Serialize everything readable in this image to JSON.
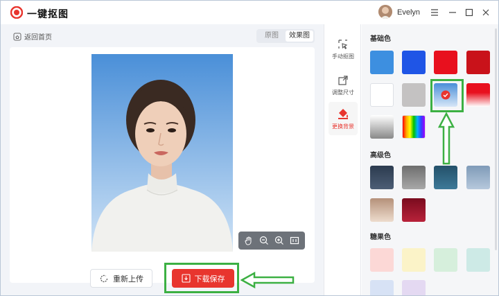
{
  "app": {
    "title": "一键抠图",
    "username": "Evelyn"
  },
  "toolbar": {
    "back_label": "返回首页",
    "view_original": "原图",
    "view_result": "效果图"
  },
  "actions": {
    "reupload_label": "重新上传",
    "download_label": "下载保存"
  },
  "tools": [
    {
      "label": "手动抠图",
      "icon": "cursor-select-icon"
    },
    {
      "label": "调整尺寸",
      "icon": "resize-icon"
    },
    {
      "label": "更换背景",
      "icon": "paint-bucket-icon"
    }
  ],
  "colors": {
    "accent_red": "#e8352e",
    "highlight_green": "#3cb043"
  },
  "panel": {
    "basic_title": "基础色",
    "advanced_title": "高级色",
    "candy_title": "糖果色",
    "basic_swatches": [
      "#3d8fe0",
      "#1f55e6",
      "#e8101e",
      "#c9121a",
      "#ffffff",
      "#c4c2c2",
      "#4a8fd8-#d6e6f7 gradient (selected)",
      "#e8101e-#ffffff gradient",
      "#ffffff-#888888 gradient",
      "rainbow"
    ],
    "advanced_swatches": [
      "#2f3e52",
      "#7c7c7c",
      "#2b5d78",
      "#8aa6c2",
      "#c9a58a",
      "#8e1025"
    ],
    "candy_swatches": [
      "#fcd8d6",
      "#fbf3c8",
      "#d6efdc",
      "#cdeae6",
      "#d7e2f5",
      "#e4d9f2"
    ]
  }
}
